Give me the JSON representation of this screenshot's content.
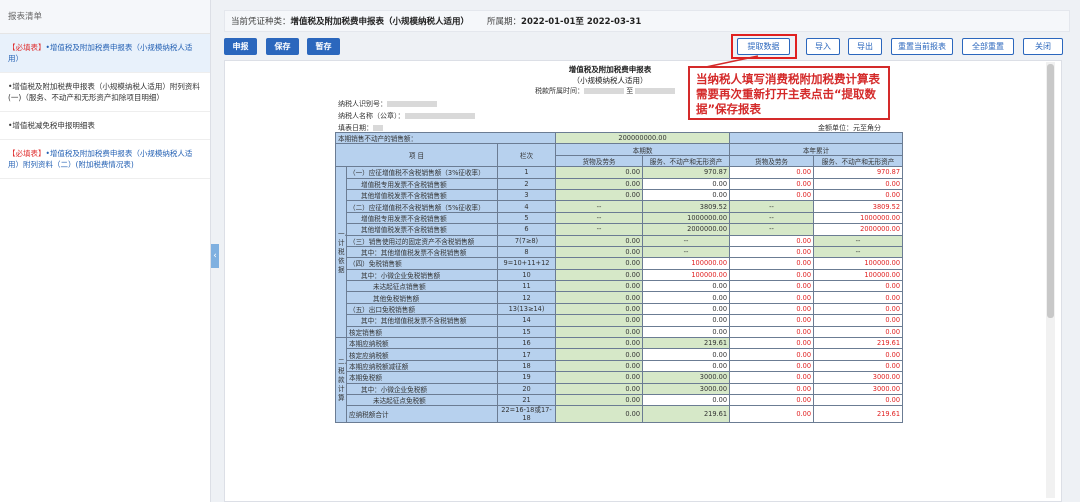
{
  "sidebar": {
    "header": "报表清单",
    "items": [
      {
        "required": "【必填表】",
        "name": "•增值税及附加税费申报表（小规模纳税人适用）",
        "active": true
      },
      {
        "required": "",
        "name": "•增值税及附加税费申报表（小规模纳税人适用）附列资料(一)（服务、不动产和无形资产扣除项目明细）",
        "active": false
      },
      {
        "required": "",
        "name": "•增值税减免税申报明细表",
        "active": false
      },
      {
        "required": "【必填表】",
        "name": "•增值税及附加税费申报表（小规模纳税人适用）附列资料（二）(附加税费情况表)",
        "active": false
      }
    ]
  },
  "topbar": {
    "type_label": "当前凭证种类：",
    "type_value": "增值税及附加税费申报表（小规模纳税人适用）",
    "period_label": "所属期：",
    "period_value": "2022-01-01至 2022-03-31"
  },
  "toolbar": {
    "declare": "申报",
    "save": "保存",
    "stash": "暂存",
    "extract": "提取数据",
    "import": "导入",
    "export": "导出",
    "reset_current": "重置当前报表",
    "reset_all": "全部重置",
    "close": "关闭"
  },
  "callout": "当纳税人填写消费税附加税费计算表需要再次重新打开主表点击“提取数据”保存报表",
  "form": {
    "title1": "增值税及附加税费申报表",
    "title2": "（小规模纳税人适用）",
    "period_label": "税款所属时间：",
    "period_mid": "至",
    "taxpayer_id": "纳税人识别号：",
    "taxpayer_name": "纳税人名称（公章）：",
    "fill_date": "填表日期：",
    "unit": "金额单位：元至角分",
    "prev_sales_label": "本期销售不动产的销售额：",
    "prev_sales_value": "200000000.00",
    "h_item": "项 目",
    "h_col": "栏次",
    "h_current": "本期数",
    "h_ytd": "本年累计",
    "h_goods": "货物及劳务",
    "h_service": "服务、不动产和无形资产",
    "section1": "一、计税依据",
    "section2": "二、税款计算",
    "rows": [
      {
        "item": "（一）应征增值税不含税销售额（3%征收率）",
        "col": "1",
        "a": "0.00",
        "b": "970.87",
        "c": "0.00",
        "d": "970.87",
        "indent": 0
      },
      {
        "item": "增值税专用发票不含税销售额",
        "col": "2",
        "a": "0.00",
        "b": "0.00",
        "c": "0.00",
        "d": "0.00",
        "indent": 1
      },
      {
        "item": "其他增值税发票不含税销售额",
        "col": "3",
        "a": "0.00",
        "b": "0.00",
        "c": "0.00",
        "d": "0.00",
        "indent": 1
      },
      {
        "item": "（二）应征增值税不含税销售额（5%征收率）",
        "col": "4",
        "a": "--",
        "b": "3809.52",
        "c": "--",
        "d": "3809.52",
        "indent": 0
      },
      {
        "item": "增值税专用发票不含税销售额",
        "col": "5",
        "a": "--",
        "b": "1000000.00",
        "c": "--",
        "d": "1000000.00",
        "indent": 1
      },
      {
        "item": "其他增值税发票不含税销售额",
        "col": "6",
        "a": "--",
        "b": "2000000.00",
        "c": "--",
        "d": "2000000.00",
        "indent": 1
      },
      {
        "item": "（三）销售使用过的固定资产不含税销售额",
        "col": "7(7≥8)",
        "a": "0.00",
        "b": "--",
        "c": "0.00",
        "d": "--",
        "indent": 0
      },
      {
        "item": "其中：其他增值税发票不含税销售额",
        "col": "8",
        "a": "0.00",
        "b": "--",
        "c": "0.00",
        "d": "--",
        "indent": 1
      },
      {
        "item": "（四）免税销售额",
        "col": "9=10+11+12",
        "a": "0.00",
        "b": "100000.00",
        "c": "0.00",
        "d": "100000.00",
        "indent": 0
      },
      {
        "item": "其中：小微企业免税销售额",
        "col": "10",
        "a": "0.00",
        "b": "100000.00",
        "c": "0.00",
        "d": "100000.00",
        "indent": 1
      },
      {
        "item": "未达起征点销售额",
        "col": "11",
        "a": "0.00",
        "b": "0.00",
        "c": "0.00",
        "d": "0.00",
        "indent": 2
      },
      {
        "item": "其他免税销售额",
        "col": "12",
        "a": "0.00",
        "b": "0.00",
        "c": "0.00",
        "d": "0.00",
        "indent": 2
      },
      {
        "item": "（五）出口免税销售额",
        "col": "13(13≥14)",
        "a": "0.00",
        "b": "0.00",
        "c": "0.00",
        "d": "0.00",
        "indent": 0
      },
      {
        "item": "其中：其他增值税发票不含税销售额",
        "col": "14",
        "a": "0.00",
        "b": "0.00",
        "c": "0.00",
        "d": "0.00",
        "indent": 1
      },
      {
        "item": "核定销售额",
        "col": "15",
        "a": "0.00",
        "b": "0.00",
        "c": "0.00",
        "d": "0.00",
        "indent": 0
      },
      {
        "item": "本期应纳税额",
        "col": "16",
        "a": "0.00",
        "b": "219.61",
        "c": "0.00",
        "d": "219.61",
        "indent": 0
      },
      {
        "item": "核定应纳税额",
        "col": "17",
        "a": "0.00",
        "b": "0.00",
        "c": "0.00",
        "d": "0.00",
        "indent": 0
      },
      {
        "item": "本期应纳税额减征额",
        "col": "18",
        "a": "0.00",
        "b": "0.00",
        "c": "0.00",
        "d": "0.00",
        "indent": 0
      },
      {
        "item": "本期免税额",
        "col": "19",
        "a": "0.00",
        "b": "3000.00",
        "c": "0.00",
        "d": "3000.00",
        "indent": 0
      },
      {
        "item": "其中：小微企业免税额",
        "col": "20",
        "a": "0.00",
        "b": "3000.00",
        "c": "0.00",
        "d": "3000.00",
        "indent": 1
      },
      {
        "item": "未达起征点免税额",
        "col": "21",
        "a": "0.00",
        "b": "0.00",
        "c": "0.00",
        "d": "0.00",
        "indent": 2
      },
      {
        "item": "应纳税额合计",
        "col": "22=16-18或17-18",
        "a": "0.00",
        "b": "219.61",
        "c": "0.00",
        "d": "219.61",
        "indent": 0
      }
    ]
  }
}
